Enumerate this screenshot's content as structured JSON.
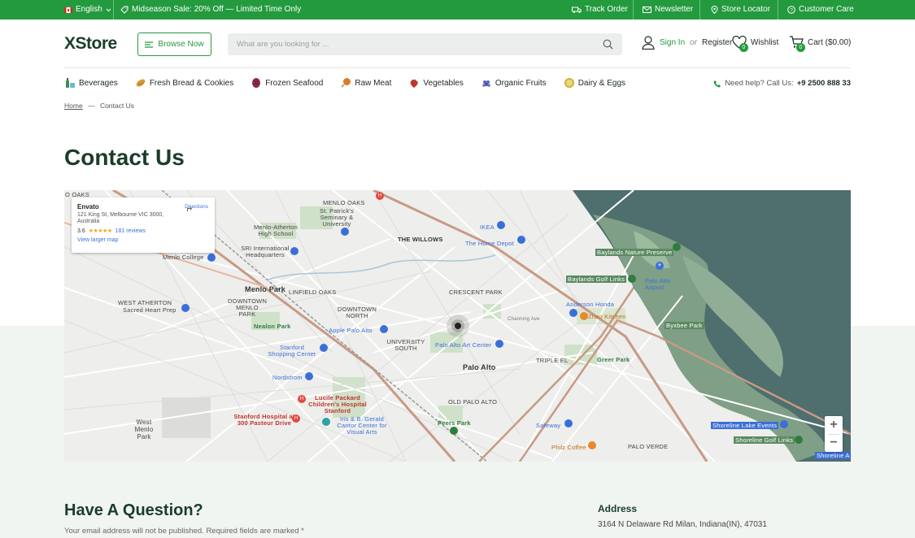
{
  "topbar": {
    "language": "English",
    "promo": "Midseason Sale: 20% Off — Limited Time Only",
    "links": [
      "Track Order",
      "Newsletter",
      "Store Locator",
      "Customer Care"
    ]
  },
  "header": {
    "logo": "XStore",
    "browse_label": "Browse Now",
    "search_placeholder": "What are you looking for ...",
    "sign_in": "Sign In",
    "or": "or",
    "register": "Register",
    "wishlist": "Wishlist",
    "wishlist_count": "0",
    "cart": "Cart ($0.00)",
    "cart_count": "0"
  },
  "categories": [
    {
      "label": "Beverages",
      "color": "#3c8f4b"
    },
    {
      "label": "Fresh Bread & Cookies",
      "color": "#d99a3a"
    },
    {
      "label": "Frozen Seafood",
      "color": "#8b2b46"
    },
    {
      "label": "Raw Meat",
      "color": "#e07a27"
    },
    {
      "label": "Vegetables",
      "color": "#c7332f"
    },
    {
      "label": "Organic Fruits",
      "color": "#5a5fb5"
    },
    {
      "label": "Dairy & Eggs",
      "color": "#c9b43a"
    }
  ],
  "help": {
    "text": "Need help? Call Us:",
    "phone": "+9 2500 888 33"
  },
  "breadcrumb": {
    "home": "Home",
    "sep": "—",
    "current": "Contact Us"
  },
  "page_title": "Contact Us",
  "map": {
    "info": {
      "name": "Envato",
      "address": "121 King St, Melbourne VIC 3000, Australia",
      "rating": "3.6",
      "stars": "★★★★★",
      "reviews": "181 reviews",
      "larger": "View larger map",
      "directions": "Directions"
    },
    "labels": {
      "oaks": "O OAKS",
      "menlo_oaks": "MENLO OAKS",
      "st_patricks": "St. Patrick's Seminary & University",
      "menlo_atherton": "Menlo-Atherton High School",
      "the_willows": "THE WILLOWS",
      "ikea": "IKEA",
      "home_depot": "The Home Depot",
      "sri": "SRI International Headquarters",
      "menlo_college": "Menlo College",
      "baylands_nature": "Baylands Nature Preserve",
      "baylands_golf": "Baylands Golf Links",
      "palo_alto_airport": "Palo Alto Airport",
      "menlo_park": "Menlo Park",
      "linfield": "LINFIELD OAKS",
      "crescent": "CRESCENT PARK",
      "west_atherton": "WEST ATHERTON",
      "sacred_heart": "Sacred Heart Prep",
      "downtown_mp": "DOWNTOWN MENLO PARK",
      "downtown_north": "DOWNTOWN NORTH",
      "anderson": "Anderson Honda",
      "zhao": "Zhao Kitchen",
      "nealon": "Nealon Park",
      "apple": "Apple Palo Alto",
      "university_south": "UNIVERSITY SOUTH",
      "art_center": "Palo Alto Art Center",
      "byxbee": "Byxbee Park",
      "stanford_sc": "Stanford Shopping Center",
      "palo_alto": "Palo Alto",
      "triple_el": "TRIPLE EL",
      "greer": "Greer Park",
      "nordstrom": "Nordstrom",
      "lucile": "Lucile Packard Children's Hospital Stanford",
      "old_palo_alto": "OLD PALO ALTO",
      "west_menlo": "West Menlo Park",
      "stanford_hosp": "Stanford Hospital at 300 Pasteur Drive",
      "cantor": "Iris & B. Gerald Cantor Center for Visual Arts",
      "peers": "Peers Park",
      "safeway": "Safeway",
      "shoreline": "Shoreline Lake Events",
      "shoreline_golf": "Shoreline Golf Links",
      "philz": "Philz Coffee",
      "palo_verde": "PALO VERDE",
      "shoreline_a": "Shoreline A",
      "channing": "Channing Ave"
    },
    "zoom_in": "+",
    "zoom_out": "−"
  },
  "form": {
    "heading": "Have A Question?",
    "note": "Your email address will not be published. Required fields are marked *"
  },
  "address": {
    "heading": "Address",
    "value": "3164 N Delaware Rd Milan, Indiana(IN), 47031"
  }
}
